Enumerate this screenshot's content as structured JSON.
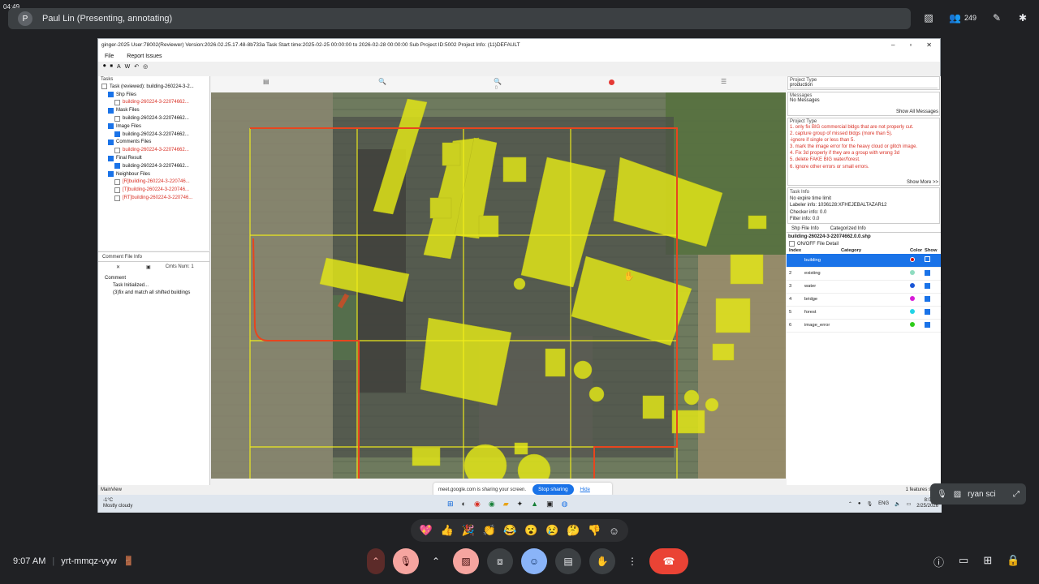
{
  "corner_clock": "04:49",
  "presenter_bar": {
    "avatar_letter": "P",
    "label": "Paul Lin (Presenting, annotating)"
  },
  "participants_count": "249",
  "app": {
    "title": "ginger-2025   User:78002(Reviewer)   Version:2026.02.25.17.48-8b733a   Task Start time:2025-02-25 00:00:00 to 2026-02-28 00:00:00   Sub Project ID:5002   Project Info: (11)DEFAULT",
    "menu": [
      "File",
      "Report Issues"
    ],
    "tasks_label": "Tasks",
    "tree": [
      {
        "indent": 0,
        "text": "Task (reviewed): building-260224-3-2...",
        "checked": false,
        "red": false
      },
      {
        "indent": 1,
        "text": "Shp Files",
        "checked": true,
        "red": false
      },
      {
        "indent": 2,
        "text": "building-260224-3-22074662...",
        "checked": false,
        "red": true
      },
      {
        "indent": 1,
        "text": "Mask Files",
        "checked": true,
        "red": false
      },
      {
        "indent": 2,
        "text": "building-260224-3-22074662...",
        "checked": false,
        "red": false
      },
      {
        "indent": 1,
        "text": "Image Files",
        "checked": true,
        "red": false
      },
      {
        "indent": 2,
        "text": "building-260224-3-22074662...",
        "checked": true,
        "red": false
      },
      {
        "indent": 1,
        "text": "Comments Files",
        "checked": true,
        "red": false
      },
      {
        "indent": 2,
        "text": "building-260224-3-22074662...",
        "checked": false,
        "red": true
      },
      {
        "indent": 1,
        "text": "Final Result",
        "checked": true,
        "red": false
      },
      {
        "indent": 2,
        "text": "building-260224-3-22074662...",
        "checked": true,
        "red": false
      },
      {
        "indent": 1,
        "text": "Neighbour Files",
        "checked": true,
        "red": false
      },
      {
        "indent": 2,
        "text": "[R]building-260224-3-220746...",
        "checked": false,
        "red": true
      },
      {
        "indent": 2,
        "text": "[T]building-260224-3-220746...",
        "checked": false,
        "red": true
      },
      {
        "indent": 2,
        "text": "[RT]building-260224-3-220746...",
        "checked": false,
        "red": true
      }
    ],
    "comment_panel": {
      "tab": "Comment File Info",
      "close": "✕",
      "cmts_label": "Cmts Num:",
      "cmts_value": "1",
      "header": "Comment",
      "lines": [
        "Task Initialized...",
        "(3)fix and match all shifted buildings"
      ]
    },
    "right": {
      "project_type_label": "Project Type",
      "project_type_value": "production",
      "messages_label": "Messages",
      "messages_value": "No Messages",
      "show_all": "Show All Messages",
      "project_type2_label": "Project Type",
      "instructions": [
        "1. only fix BIG commercial bldgs that are not properly cut.",
        "2. capture group of missed bldgs (more than 5).",
        "-ignore if single or less than 5.",
        "3. mark the image error for the heavy cloud or glitch image.",
        "4. Fix 3d properly if they are a group with wrong 3d",
        "5. delete FAKE BIG water/forest.",
        "6. ignore other errors or small errors."
      ],
      "show_more": "Show More >>",
      "task_info_label": "Task Info",
      "task_info": [
        "No expire time limit",
        "Labeler info: 1036128:XFHEJEBALTAZAR12",
        "Checker info: 0.0",
        "Filter info: 0.0"
      ],
      "tabs": [
        "Shp File Info",
        "Categorized Info"
      ],
      "shp_name": "building-260224-3-22074662.0.0.shp",
      "onoff": "ON/OFF File Detail",
      "table_headers": [
        "Index",
        "Category",
        "Color",
        "Show"
      ],
      "rows": [
        {
          "index": "",
          "category": "building",
          "color": "#d50000",
          "selected": true
        },
        {
          "index": "2",
          "category": "existing",
          "color": "#8fdcc0",
          "selected": false
        },
        {
          "index": "3",
          "category": "water",
          "color": "#1a56d6",
          "selected": false
        },
        {
          "index": "4",
          "category": "bridge",
          "color": "#d81bd8",
          "selected": false
        },
        {
          "index": "5",
          "category": "forest",
          "color": "#22d3e6",
          "selected": false
        },
        {
          "index": "6",
          "category": "image_error",
          "color": "#2ecc1a",
          "selected": false
        }
      ]
    },
    "status_left": "MainView",
    "status_right": "1 features selec",
    "share_text": "meet.google.com is sharing your screen.",
    "stop_sharing": "Stop sharing",
    "hide": "Hide",
    "weather_temp": "-1°C",
    "weather_desc": "Mostly cloudy",
    "lang": "ENG",
    "tray_time": "8:07 P",
    "tray_date": "2/25/2026"
  },
  "ryan_tile": {
    "name": "ryan sci"
  },
  "reactions": [
    "💖",
    "👍",
    "🎉",
    "👏",
    "😂",
    "😮",
    "😢",
    "🤔",
    "👎",
    "☺"
  ],
  "meeting": {
    "time": "9:07 AM",
    "code": "yrt-mmqz-vyw"
  },
  "colors": {
    "annotation_red": "#e8451e",
    "building_yellow": "#e6ea16",
    "grid_yellow": "#f2ef1a"
  }
}
